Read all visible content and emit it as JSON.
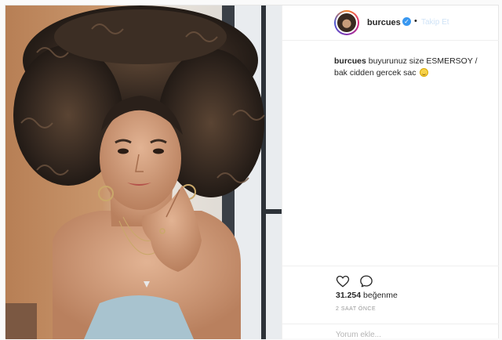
{
  "post": {
    "photo_alt": "post-photo",
    "username": "burcues",
    "verified_icon": "verified-badge-icon",
    "follow_dot": "•",
    "follow_label": "Takip Et",
    "caption_user": "burcues",
    "caption_text": "buyurunuz size ESMERSOY / bak cidden gercek sac",
    "likes_count": "31.254",
    "likes_label": "beğenme",
    "time_ago": "2 SAAT ÖNCE",
    "comment_placeholder": "Yorum ekle..."
  },
  "icons": {
    "like": "heart-outline-icon",
    "comment": "speech-bubble-icon",
    "emoji": "grinning-face-emoji"
  },
  "colors": {
    "verified": "#3897f0",
    "text": "#262626",
    "muted": "#999999"
  }
}
